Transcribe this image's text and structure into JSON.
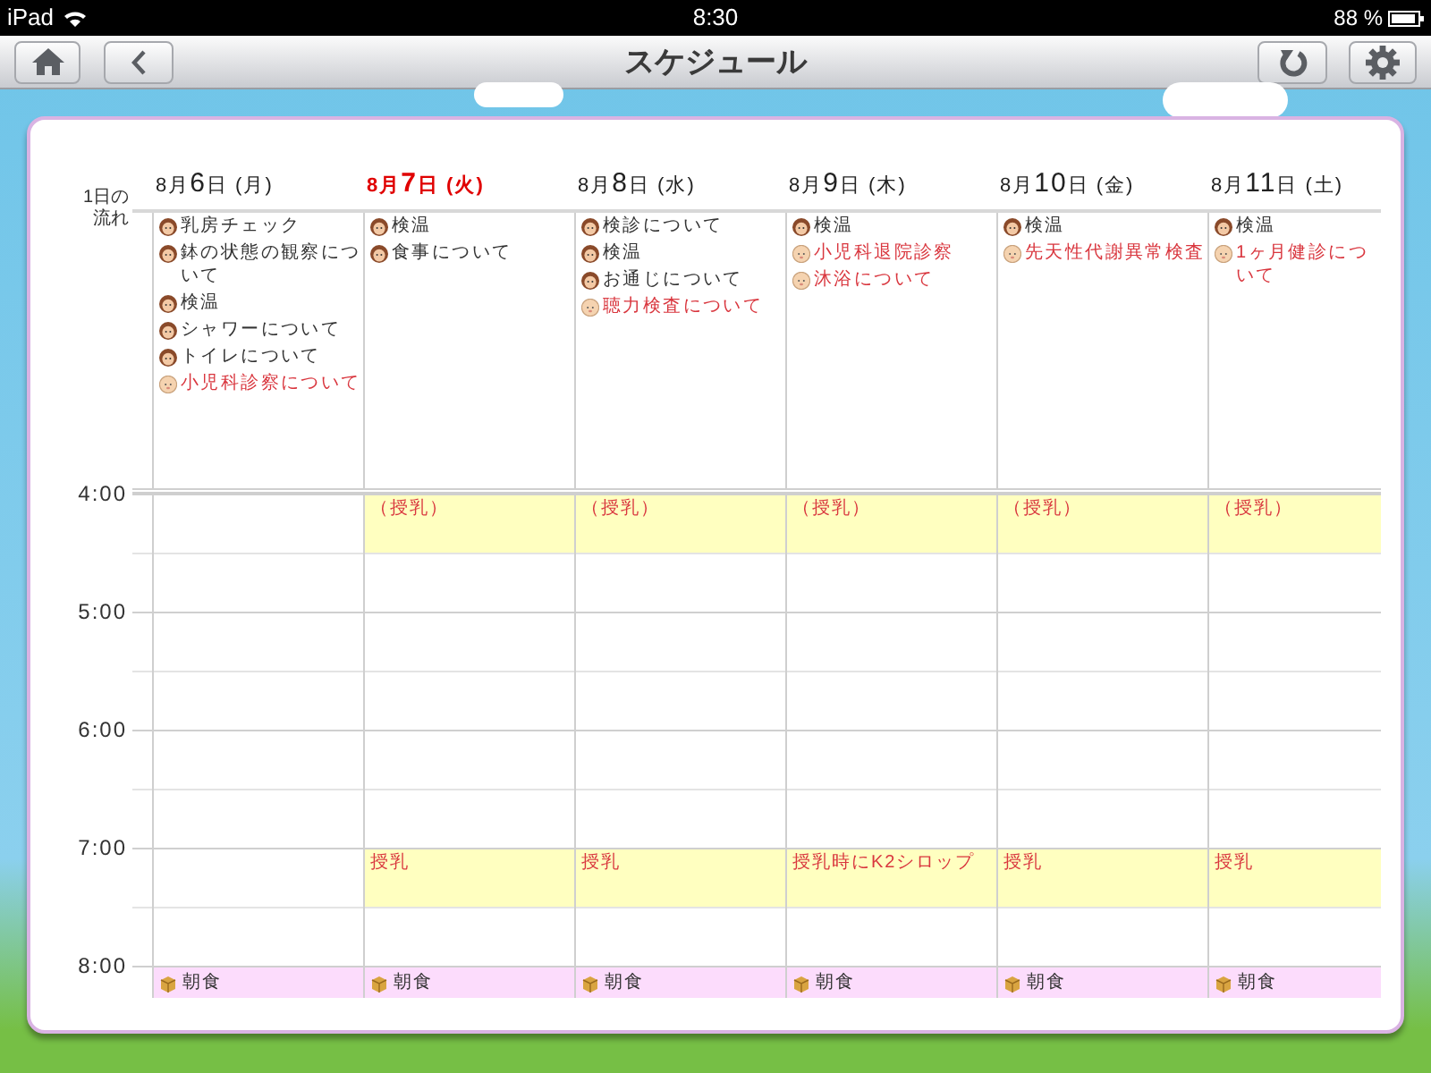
{
  "status_bar": {
    "device": "iPad",
    "time": "8:30",
    "battery": "88 %"
  },
  "nav_bar": {
    "title": "スケジュール"
  },
  "schedule": {
    "flow_label": "1日の流れ",
    "days": [
      {
        "month": "8月",
        "day": "6",
        "suffix": "日 (月)",
        "today": false,
        "notes": [
          {
            "kind": "mother",
            "text": "乳房チェック"
          },
          {
            "kind": "mother",
            "text": "鉢の状態の観察について"
          },
          {
            "kind": "mother",
            "text": "検温"
          },
          {
            "kind": "mother",
            "text": "シャワーについて"
          },
          {
            "kind": "mother",
            "text": "トイレについて"
          },
          {
            "kind": "baby",
            "text": "小児科診察について"
          }
        ]
      },
      {
        "month": "8月",
        "day": "7",
        "suffix": "日 (火)",
        "today": true,
        "notes": [
          {
            "kind": "mother",
            "text": "検温"
          },
          {
            "kind": "mother",
            "text": "食事について"
          }
        ]
      },
      {
        "month": "8月",
        "day": "8",
        "suffix": "日 (水)",
        "today": false,
        "notes": [
          {
            "kind": "mother",
            "text": "検診について"
          },
          {
            "kind": "mother",
            "text": "検温"
          },
          {
            "kind": "mother",
            "text": "お通じについて"
          },
          {
            "kind": "baby",
            "text": "聴力検査について"
          }
        ]
      },
      {
        "month": "8月",
        "day": "9",
        "suffix": "日 (木)",
        "today": false,
        "notes": [
          {
            "kind": "mother",
            "text": "検温"
          },
          {
            "kind": "baby",
            "text": "小児科退院診察"
          },
          {
            "kind": "baby",
            "text": "沐浴について"
          }
        ]
      },
      {
        "month": "8月",
        "day": "10",
        "suffix": "日 (金)",
        "today": false,
        "notes": [
          {
            "kind": "mother",
            "text": "検温"
          },
          {
            "kind": "baby",
            "text": "先天性代謝異常検査"
          }
        ]
      },
      {
        "month": "8月",
        "day": "11",
        "suffix": "日 (土)",
        "today": false,
        "notes": [
          {
            "kind": "mother",
            "text": "検温"
          },
          {
            "kind": "baby",
            "text": "1ヶ月健診について"
          }
        ]
      }
    ],
    "hours": [
      {
        "label": "4:00",
        "cells": [
          null,
          {
            "kind": "feeding",
            "text": "（授乳）"
          },
          {
            "kind": "feeding",
            "text": "（授乳）"
          },
          {
            "kind": "feeding",
            "text": "（授乳）"
          },
          {
            "kind": "feeding",
            "text": "（授乳）"
          },
          {
            "kind": "feeding",
            "text": "（授乳）"
          }
        ]
      },
      {
        "label": "5:00",
        "cells": [
          null,
          null,
          null,
          null,
          null,
          null
        ]
      },
      {
        "label": "6:00",
        "cells": [
          null,
          null,
          null,
          null,
          null,
          null
        ]
      },
      {
        "label": "7:00",
        "cells": [
          null,
          {
            "kind": "feeding",
            "text": "授乳"
          },
          {
            "kind": "feeding",
            "text": "授乳"
          },
          {
            "kind": "feeding",
            "text": "授乳時にK2シロップ"
          },
          {
            "kind": "feeding",
            "text": "授乳"
          },
          {
            "kind": "feeding",
            "text": "授乳"
          }
        ]
      },
      {
        "label": "8:00",
        "cells": [
          {
            "kind": "meal",
            "text": "朝食"
          },
          {
            "kind": "meal",
            "text": "朝食"
          },
          {
            "kind": "meal",
            "text": "朝食"
          },
          {
            "kind": "meal",
            "text": "朝食"
          },
          {
            "kind": "meal",
            "text": "朝食"
          },
          {
            "kind": "meal",
            "text": "朝食"
          }
        ]
      }
    ]
  }
}
